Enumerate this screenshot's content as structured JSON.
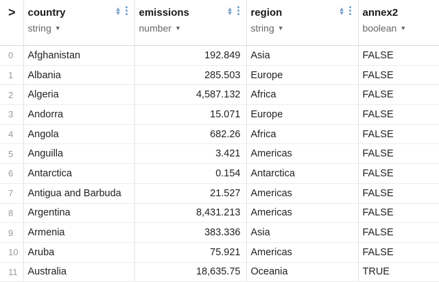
{
  "columns": [
    {
      "name": "country",
      "type": "string"
    },
    {
      "name": "emissions",
      "type": "number"
    },
    {
      "name": "region",
      "type": "string"
    },
    {
      "name": "annex2",
      "type": "boolean"
    }
  ],
  "rows": [
    {
      "index": "0",
      "country": "Afghanistan",
      "emissions": "192.849",
      "region": "Asia",
      "annex2": "FALSE"
    },
    {
      "index": "1",
      "country": "Albania",
      "emissions": "285.503",
      "region": "Europe",
      "annex2": "FALSE"
    },
    {
      "index": "2",
      "country": "Algeria",
      "emissions": "4,587.132",
      "region": "Africa",
      "annex2": "FALSE"
    },
    {
      "index": "3",
      "country": "Andorra",
      "emissions": "15.071",
      "region": "Europe",
      "annex2": "FALSE"
    },
    {
      "index": "4",
      "country": "Angola",
      "emissions": "682.26",
      "region": "Africa",
      "annex2": "FALSE"
    },
    {
      "index": "5",
      "country": "Anguilla",
      "emissions": "3.421",
      "region": "Americas",
      "annex2": "FALSE"
    },
    {
      "index": "6",
      "country": "Antarctica",
      "emissions": "0.154",
      "region": "Antarctica",
      "annex2": "FALSE"
    },
    {
      "index": "7",
      "country": "Antigua and Barbuda",
      "emissions": "21.527",
      "region": "Americas",
      "annex2": "FALSE"
    },
    {
      "index": "8",
      "country": "Argentina",
      "emissions": "8,431.213",
      "region": "Americas",
      "annex2": "FALSE"
    },
    {
      "index": "9",
      "country": "Armenia",
      "emissions": "383.336",
      "region": "Asia",
      "annex2": "FALSE"
    },
    {
      "index": "10",
      "country": "Aruba",
      "emissions": "75.921",
      "region": "Americas",
      "annex2": "FALSE"
    },
    {
      "index": "11",
      "country": "Australia",
      "emissions": "18,635.75",
      "region": "Oceania",
      "annex2": "TRUE"
    }
  ],
  "icons": {
    "expand": "chevron-right-icon",
    "sort": "sort-icon",
    "menu": "more-vertical-icon",
    "type_caret": "caret-down-icon"
  },
  "colors": {
    "accent": "#6f9fd6"
  }
}
